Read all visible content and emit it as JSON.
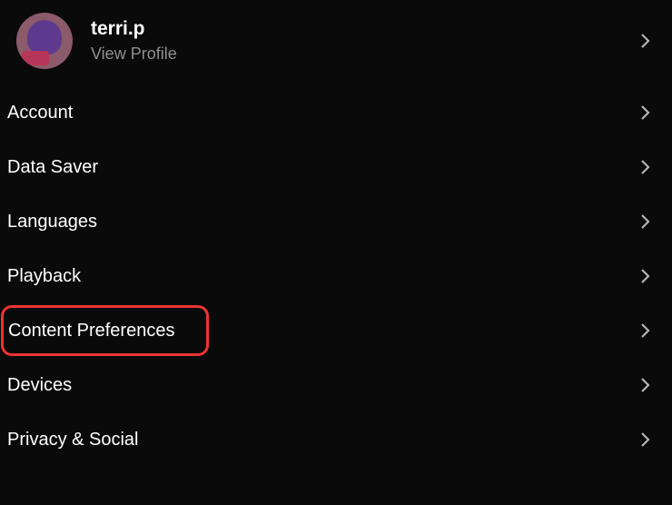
{
  "profile": {
    "name": "terri.p",
    "subtitle": "View Profile"
  },
  "menu": {
    "items": [
      {
        "label": "Account",
        "highlighted": false
      },
      {
        "label": "Data Saver",
        "highlighted": false
      },
      {
        "label": "Languages",
        "highlighted": false
      },
      {
        "label": "Playback",
        "highlighted": false
      },
      {
        "label": "Content Preferences",
        "highlighted": true
      },
      {
        "label": "Devices",
        "highlighted": false
      },
      {
        "label": "Privacy & Social",
        "highlighted": false
      }
    ]
  }
}
